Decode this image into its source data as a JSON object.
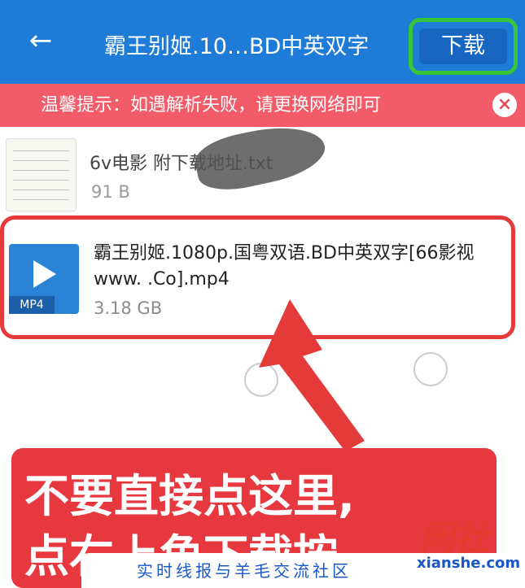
{
  "header": {
    "back_icon": "arrow-left-icon",
    "title": "霸王别姬.10…BD中英双字",
    "download_label": "下载"
  },
  "notice": {
    "text": "温馨提示：如遇解析失败，请更换网络即可",
    "close_icon": "close-icon"
  },
  "files": [
    {
      "name": "6v电影      附下载地址.txt",
      "size": "91 B",
      "type_icon": "text-file-icon"
    },
    {
      "name": "霸王别姬.1080p.国粤双语.BD中英双字[66影视www.      .Co].mp4",
      "size": "3.18 GB",
      "type_icon": "video-file-icon",
      "badge": "MP4"
    }
  ],
  "annotation": {
    "line1": "不要直接点这里,",
    "line2": "点右上角下载按"
  },
  "watermark": {
    "footer": "实时线报与羊毛交流社区",
    "logo_cn": "闲社",
    "logo_en": "xianshe.com"
  },
  "colors": {
    "header": "#1f7bd8",
    "notice": "#f25b68",
    "highlight_border": "#e53a3a",
    "download_border": "#39c53b",
    "annotation_bg": "#e7383f"
  }
}
